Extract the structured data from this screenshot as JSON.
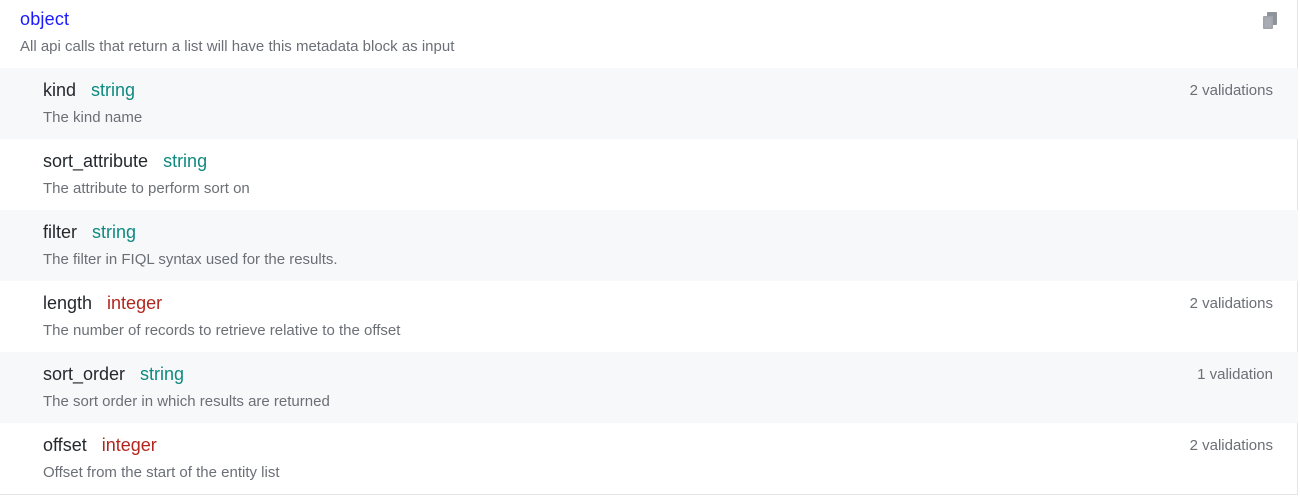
{
  "header": {
    "type_label": "object",
    "description": "All api calls that return a list will have this metadata block as input",
    "copy_icon": "copy-icon"
  },
  "colors": {
    "object_type": "#1a1aff",
    "string_type": "#0f8a80",
    "integer_type": "#b3261e",
    "muted_text": "#6b6f76",
    "row_shade": "#f7f8fa"
  },
  "properties": [
    {
      "name": "kind",
      "type": "string",
      "description": "The kind name",
      "validations": "2 validations"
    },
    {
      "name": "sort_attribute",
      "type": "string",
      "description": "The attribute to perform sort on",
      "validations": ""
    },
    {
      "name": "filter",
      "type": "string",
      "description": "The filter in FIQL syntax used for the results.",
      "validations": ""
    },
    {
      "name": "length",
      "type": "integer",
      "description": "The number of records to retrieve relative to the offset",
      "validations": "2 validations"
    },
    {
      "name": "sort_order",
      "type": "string",
      "description": "The sort order in which results are returned",
      "validations": "1 validation"
    },
    {
      "name": "offset",
      "type": "integer",
      "description": "Offset from the start of the entity list",
      "validations": "2 validations"
    }
  ]
}
